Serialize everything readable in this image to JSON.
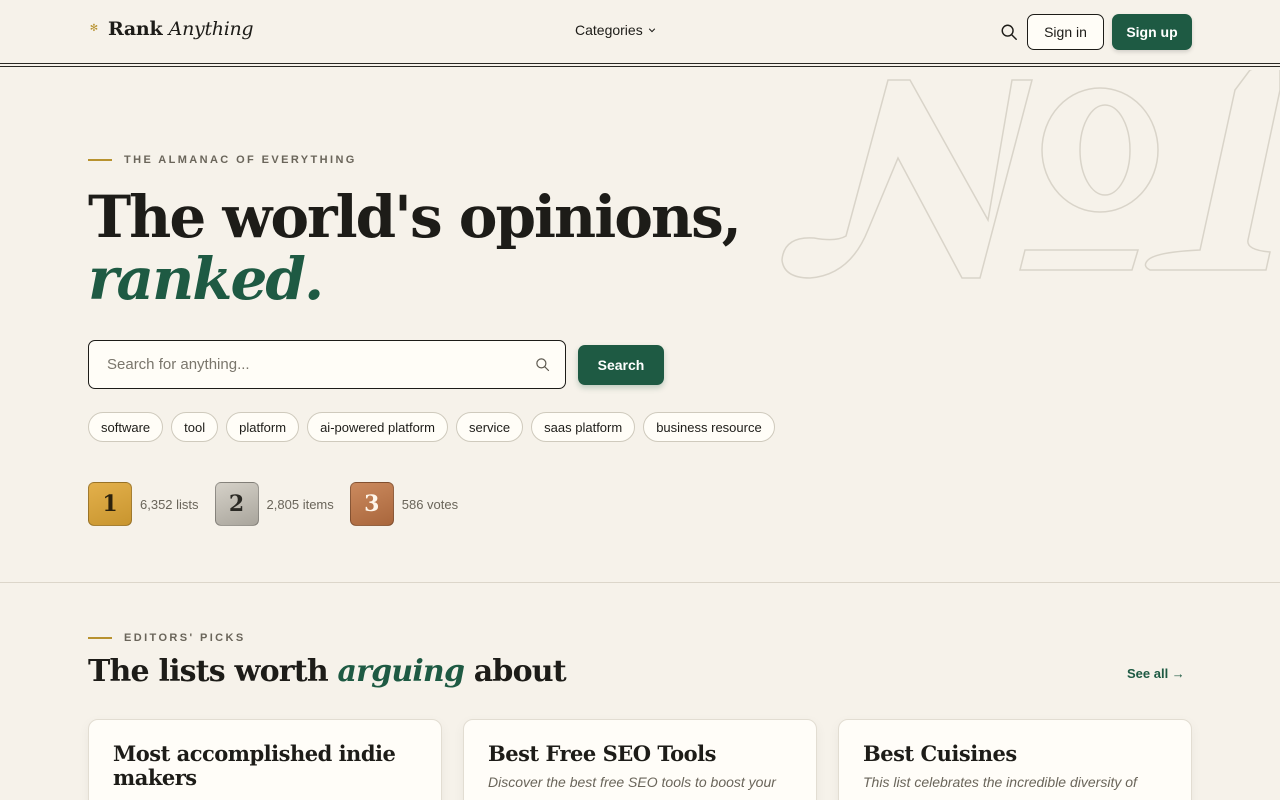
{
  "header": {
    "brand_bold": "Rank",
    "brand_italic": "Anything",
    "nav_categories": "Categories",
    "sign_in": "Sign in",
    "sign_up": "Sign up"
  },
  "hero": {
    "eyebrow": "THE ALMANAC OF EVERYTHING",
    "title_line1": "The world's opinions,",
    "title_line2": "ranked.",
    "search_placeholder": "Search for anything...",
    "search_value": "",
    "search_button": "Search",
    "tags": [
      "software",
      "tool",
      "platform",
      "ai-powered platform",
      "service",
      "saas platform",
      "business resource"
    ],
    "stats": [
      {
        "rank": "1",
        "label": "6,352 lists"
      },
      {
        "rank": "2",
        "label": "2,805 items"
      },
      {
        "rank": "3",
        "label": "586 votes"
      }
    ]
  },
  "picks": {
    "eyebrow": "EDITORS' PICKS",
    "title_start": "The lists worth ",
    "title_emph": "arguing",
    "title_end": " about",
    "see_all": "See all →",
    "cards": [
      {
        "title": "Most accomplished indie makers",
        "desc": ""
      },
      {
        "title": "Best Free SEO Tools",
        "desc": "Discover the best free SEO tools to boost your"
      },
      {
        "title": "Best Cuisines",
        "desc": "This list celebrates the incredible diversity of"
      }
    ]
  },
  "colors": {
    "background": "#f6f2ea",
    "accent_green": "#1e5a43",
    "gold": "#b8922f",
    "text": "#1d1c18"
  },
  "icons": {
    "brand": "sparkle-icon",
    "header_search": "search-icon",
    "input_search": "search-icon",
    "categories_caret": "chevron-down-icon"
  }
}
